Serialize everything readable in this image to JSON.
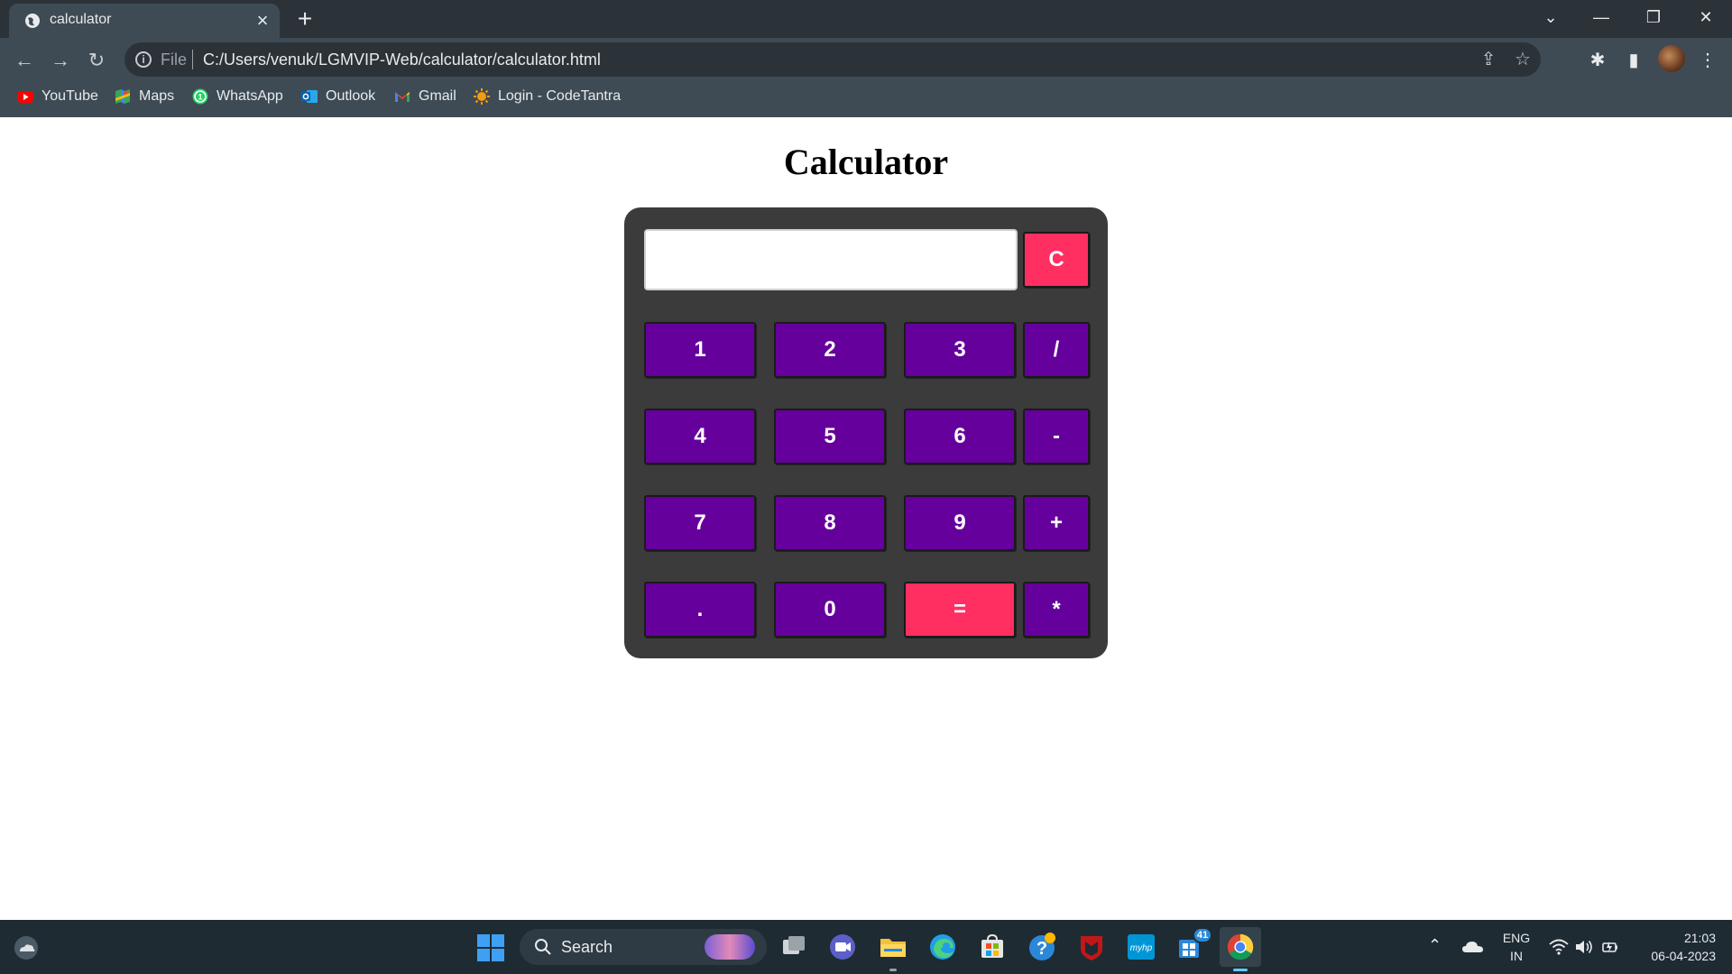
{
  "browser": {
    "tab_title": "calculator",
    "url_scheme": "File",
    "url": "C:/Users/venuk/LGMVIP-Web/calculator/calculator.html",
    "bookmarks": [
      {
        "label": "YouTube",
        "icon": "youtube-icon"
      },
      {
        "label": "Maps",
        "icon": "maps-icon"
      },
      {
        "label": "WhatsApp",
        "icon": "whatsapp-icon"
      },
      {
        "label": "Outlook",
        "icon": "outlook-icon"
      },
      {
        "label": "Gmail",
        "icon": "gmail-icon"
      },
      {
        "label": "Login - CodeTantra",
        "icon": "codetantra-icon"
      }
    ]
  },
  "page": {
    "title": "Calculator",
    "display_value": ""
  },
  "calculator": {
    "clear": "C",
    "keys": {
      "k1": "1",
      "k2": "2",
      "k3": "3",
      "div": "/",
      "k4": "4",
      "k5": "5",
      "k6": "6",
      "sub": "-",
      "k7": "7",
      "k8": "8",
      "k9": "9",
      "add": "+",
      "dot": ".",
      "k0": "0",
      "eq": "=",
      "mul": "*"
    },
    "colors": {
      "key": "#65009c",
      "accent": "#ff2f61",
      "panel": "#3b3b3b"
    }
  },
  "taskbar": {
    "search_label": "Search",
    "lang_1": "ENG",
    "lang_2": "IN",
    "time": "21:03",
    "date": "06-04-2023",
    "store_badge": "41"
  }
}
